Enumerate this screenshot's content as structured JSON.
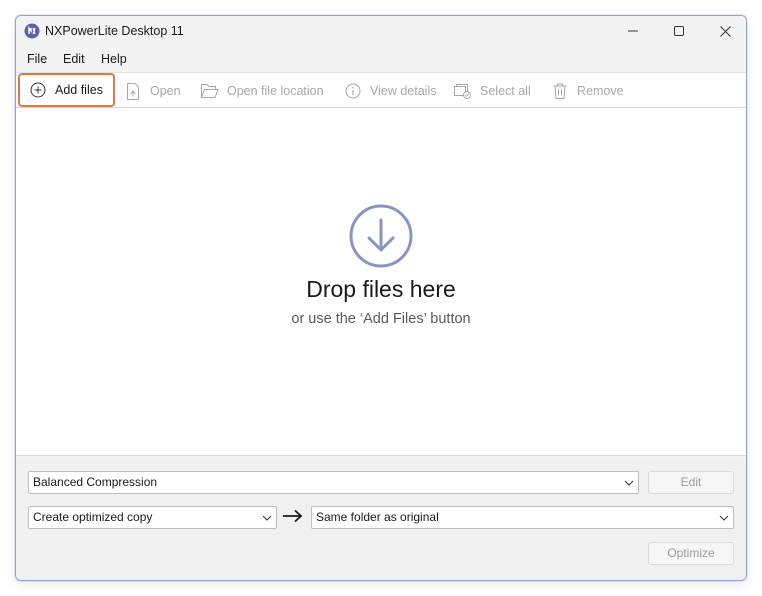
{
  "window": {
    "title": "NXPowerLite Desktop 11",
    "controls": {
      "minimize": "minimize",
      "maximize": "maximize",
      "close": "close"
    }
  },
  "menu": {
    "items": [
      "File",
      "Edit",
      "Help"
    ]
  },
  "toolbar": {
    "add_files": "Add files",
    "open": "Open",
    "open_file_location": "Open file location",
    "view_details": "View details",
    "select_all": "Select all",
    "remove": "Remove"
  },
  "dropzone": {
    "title": "Drop files here",
    "subtitle": "or use the ‘Add Files’ button"
  },
  "settings": {
    "compression_profile": "Balanced Compression",
    "edit_button": "Edit",
    "output_mode": "Create optimized copy",
    "output_location": "Same folder as original",
    "optimize_button": "Optimize"
  },
  "colors": {
    "accent_highlight": "#e07a45",
    "drop_icon": "#8a93c4",
    "window_border": "#9aa3cf"
  }
}
